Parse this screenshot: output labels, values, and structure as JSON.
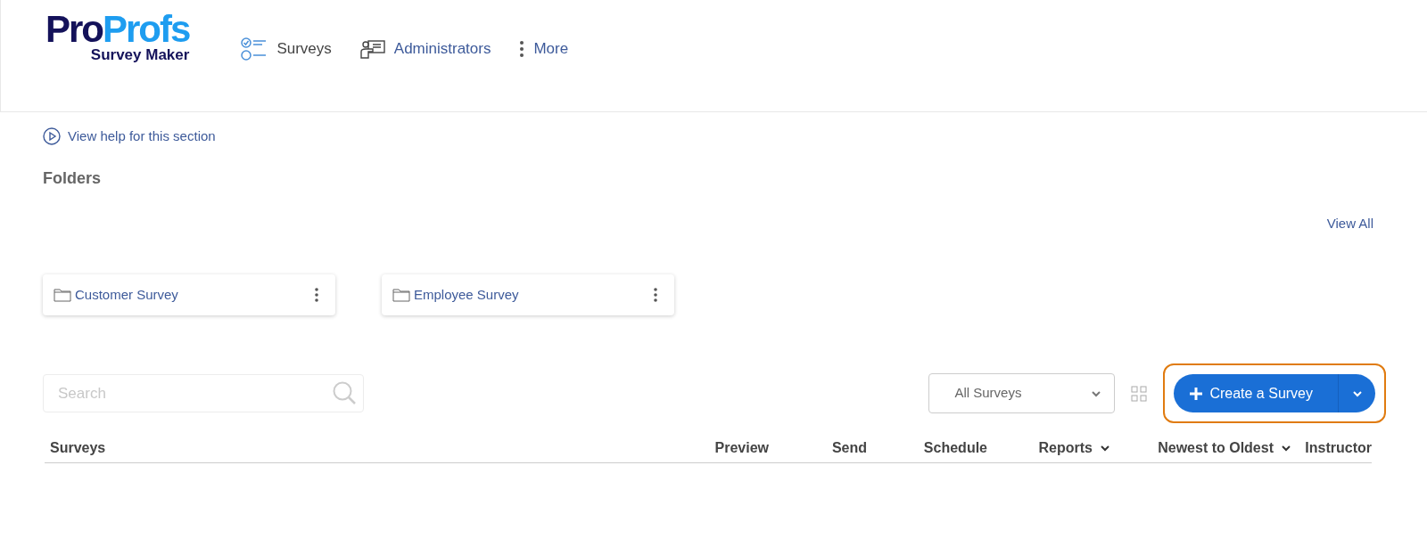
{
  "logo": {
    "brand_part_1": "Pro",
    "brand_part_2": "Profs",
    "product": "Survey Maker"
  },
  "nav": [
    {
      "kind": "surveys",
      "label": "Surveys",
      "selected": true
    },
    {
      "kind": "admins",
      "label": "Administrators",
      "selected": false
    },
    {
      "kind": "more",
      "label": "More",
      "selected": false
    }
  ],
  "help_link": "View help for this section",
  "folders": {
    "title": "Folders",
    "view_all": "View All",
    "items": [
      {
        "name": "Customer Survey"
      },
      {
        "name": "Employee Survey"
      }
    ]
  },
  "search": {
    "placeholder": "Search"
  },
  "filter": {
    "value": "All Surveys"
  },
  "create_button": {
    "label": "Create a Survey",
    "highlighted": true
  },
  "table": {
    "columns": [
      {
        "label": "Surveys",
        "dropdown": false
      },
      {
        "label": "Preview",
        "dropdown": false
      },
      {
        "label": "Send",
        "dropdown": false
      },
      {
        "label": "Schedule",
        "dropdown": false
      },
      {
        "label": "Reports",
        "dropdown": true
      },
      {
        "label": "Newest to Oldest",
        "dropdown": true
      },
      {
        "label": "Instructor",
        "dropdown": false
      }
    ]
  }
}
